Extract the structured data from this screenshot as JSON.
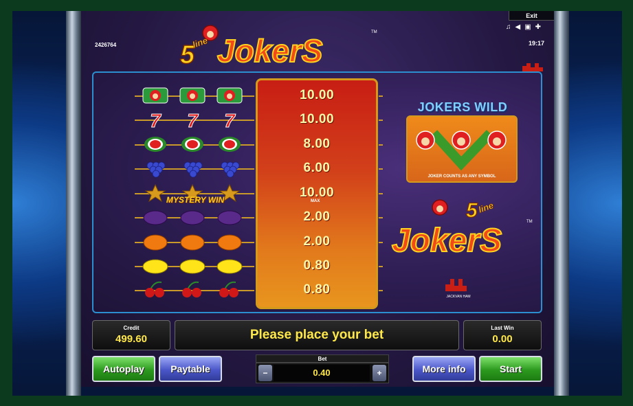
{
  "top": {
    "exit_label": "Exit",
    "game_id": "2426764",
    "clock": "19:17",
    "icons": [
      "music-note-icon",
      "speaker-icon",
      "window-icon",
      "fullscreen-icon"
    ]
  },
  "paytable": {
    "rows": [
      {
        "symbol": "joker",
        "value": "10.00"
      },
      {
        "symbol": "seven",
        "value": "10.00"
      },
      {
        "symbol": "watermelon",
        "value": "8.00"
      },
      {
        "symbol": "grapes",
        "value": "6.00"
      },
      {
        "symbol": "star",
        "value": "10.00",
        "note": "MAX"
      },
      {
        "symbol": "plum",
        "value": "2.00"
      },
      {
        "symbol": "orange",
        "value": "2.00"
      },
      {
        "symbol": "lemon",
        "value": "0.80"
      },
      {
        "symbol": "cherry",
        "value": "0.80"
      }
    ],
    "mystery_win_label": "MYSTERY WIN"
  },
  "jokers_wild": {
    "title": "JOKERS WILD",
    "note": "JOKER COUNTS AS ANY SYMBOL"
  },
  "logo": {
    "prefix": "5",
    "line": "line",
    "name": "JokerS",
    "tm": "TM"
  },
  "studio": {
    "name": "JACKVAN HAM"
  },
  "hud": {
    "credit_label": "Credit",
    "credit_value": "499.60",
    "message": "Please place your bet",
    "last_win_label": "Last Win",
    "last_win_value": "0.00",
    "bet_label": "Bet",
    "bet_value": "0.40",
    "bet_minus": "−",
    "bet_plus": "+"
  },
  "buttons": {
    "autoplay": "Autoplay",
    "paytable": "Paytable",
    "more_info": "More info",
    "start": "Start"
  },
  "colors": {
    "accent_yellow": "#ffe84a",
    "pay_red": "#c81e14",
    "frame_gold": "#d49a1c",
    "panel_border": "#2b8fd0"
  }
}
